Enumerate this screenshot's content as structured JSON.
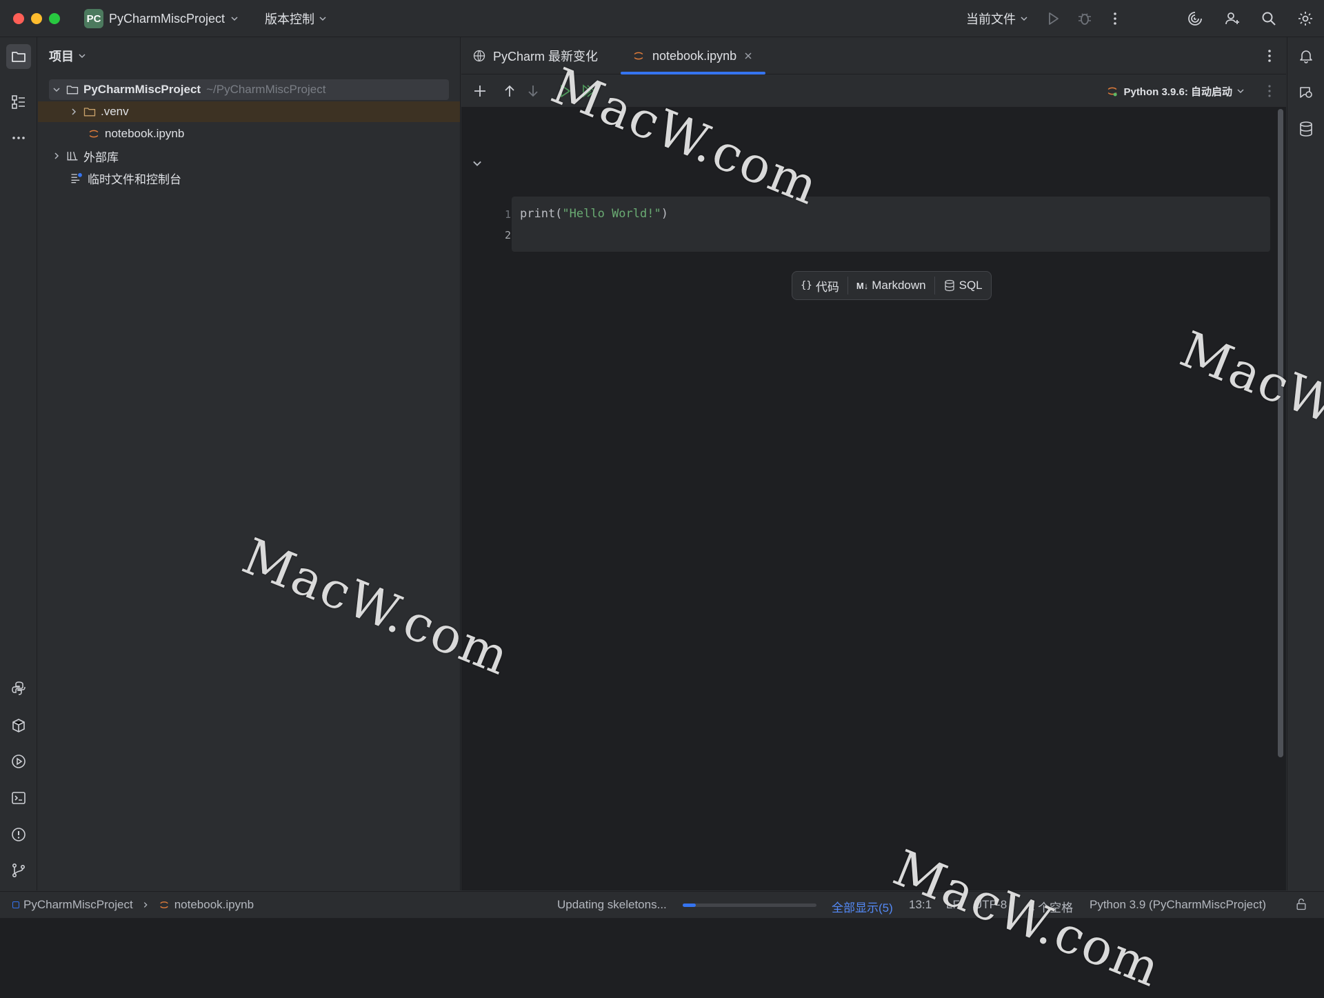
{
  "titlebar": {
    "project_badge": "PC",
    "project_name": "PyCharmMiscProject",
    "vcs_label": "版本控制",
    "run_config": "当前文件"
  },
  "project_panel": {
    "title": "项目",
    "tree": [
      {
        "label": "PyCharmMiscProject",
        "path": "~/PyCharmMiscProject"
      },
      {
        "label": ".venv"
      },
      {
        "label": "notebook.ipynb"
      },
      {
        "label": "外部库"
      },
      {
        "label": "临时文件和控制台"
      }
    ]
  },
  "editor": {
    "tabs": [
      {
        "label": "PyCharm 最新变化"
      },
      {
        "label": "notebook.ipynb"
      }
    ],
    "kernel": "Python 3.9.6: 自动启动",
    "code": {
      "line_numbers": [
        "1",
        "2"
      ],
      "func": "print(",
      "string": "\"Hello World!\"",
      "close": ")"
    },
    "add_cell": {
      "code_label": "代码",
      "markdown_icon": "M↓",
      "markdown_label": "Markdown",
      "sql_label": "SQL"
    }
  },
  "status_bar": {
    "breadcrumb": [
      "PyCharmMiscProject",
      "notebook.ipynb"
    ],
    "task": "Updating skeletons...",
    "progress": 0.1,
    "show_all": "全部显示(5)",
    "position": "13:1",
    "line_sep": "LF",
    "encoding": "UTF-8",
    "indent": "4 个空格",
    "interpreter": "Python 3.9 (PyCharmMiscProject)"
  },
  "watermark": "MacW.com",
  "colors": {
    "accent": "#3574f0",
    "string": "#6aab73",
    "venv_highlight": "#3d3223",
    "background": "#1e1f22",
    "panel": "#2b2d30"
  }
}
